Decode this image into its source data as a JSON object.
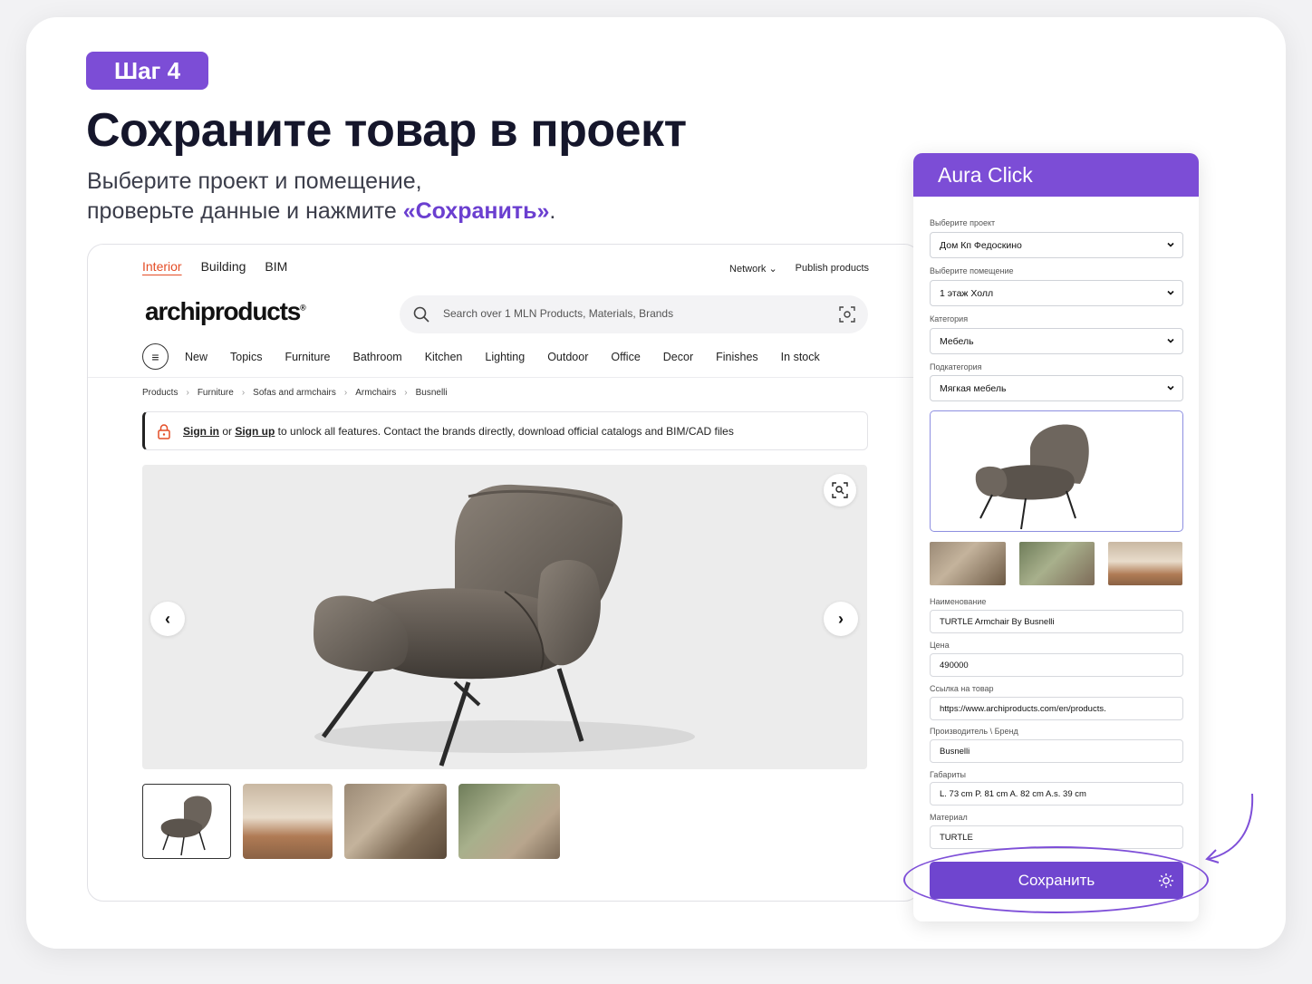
{
  "step": {
    "badge": "Шаг 4"
  },
  "heading": {
    "title": "Сохраните товар в проект",
    "subtitle_line1": "Выберите проект и помещение,",
    "subtitle_line2_pre": "проверьте данные и нажмите ",
    "subtitle_line2_highlight": "«Сохранить»",
    "subtitle_line2_post": "."
  },
  "site": {
    "topnav": [
      "Interior",
      "Building",
      "BIM"
    ],
    "topright": {
      "network": "Network",
      "publish": "Publish products"
    },
    "logo": "archiproducts",
    "search_placeholder": "Search over 1 MLN Products, Materials, Brands",
    "categories": [
      "New",
      "Topics",
      "Furniture",
      "Bathroom",
      "Kitchen",
      "Lighting",
      "Outdoor",
      "Office",
      "Decor",
      "Finishes",
      "In stock"
    ],
    "breadcrumbs": [
      "Products",
      "Furniture",
      "Sofas and armchairs",
      "Armchairs",
      "Busnelli"
    ],
    "notice": {
      "sign_in": "Sign in",
      "or": " or ",
      "sign_up": "Sign up",
      "rest": " to unlock all features. Contact the brands directly, download official catalogs and BIM/CAD files"
    }
  },
  "panel": {
    "title": "Aura Click",
    "project": {
      "label": "Выберите проект",
      "value": "Дом Кп Федоскино"
    },
    "room": {
      "label": "Выберите помещение",
      "value": "1 этаж Холл"
    },
    "category": {
      "label": "Категория",
      "value": "Мебель"
    },
    "subcategory": {
      "label": "Подкатегория",
      "value": "Мягкая мебель"
    },
    "name": {
      "label": "Наименование",
      "value": "TURTLE Armchair By Busnelli"
    },
    "price": {
      "label": "Цена",
      "value": "490000"
    },
    "link": {
      "label": "Ссылка на товар",
      "value": "https://www.archiproducts.com/en/products."
    },
    "brand": {
      "label": "Производитель \\ Бренд",
      "value": "Busnelli"
    },
    "dimensions": {
      "label": "Габариты",
      "value": "L. 73 cm P. 81 cm A. 82 cm A.s. 39 cm"
    },
    "material": {
      "label": "Материал",
      "value": "TURTLE"
    },
    "save_label": "Сохранить"
  },
  "colors": {
    "accent": "#7c4dd6",
    "active_link": "#e44d26"
  }
}
